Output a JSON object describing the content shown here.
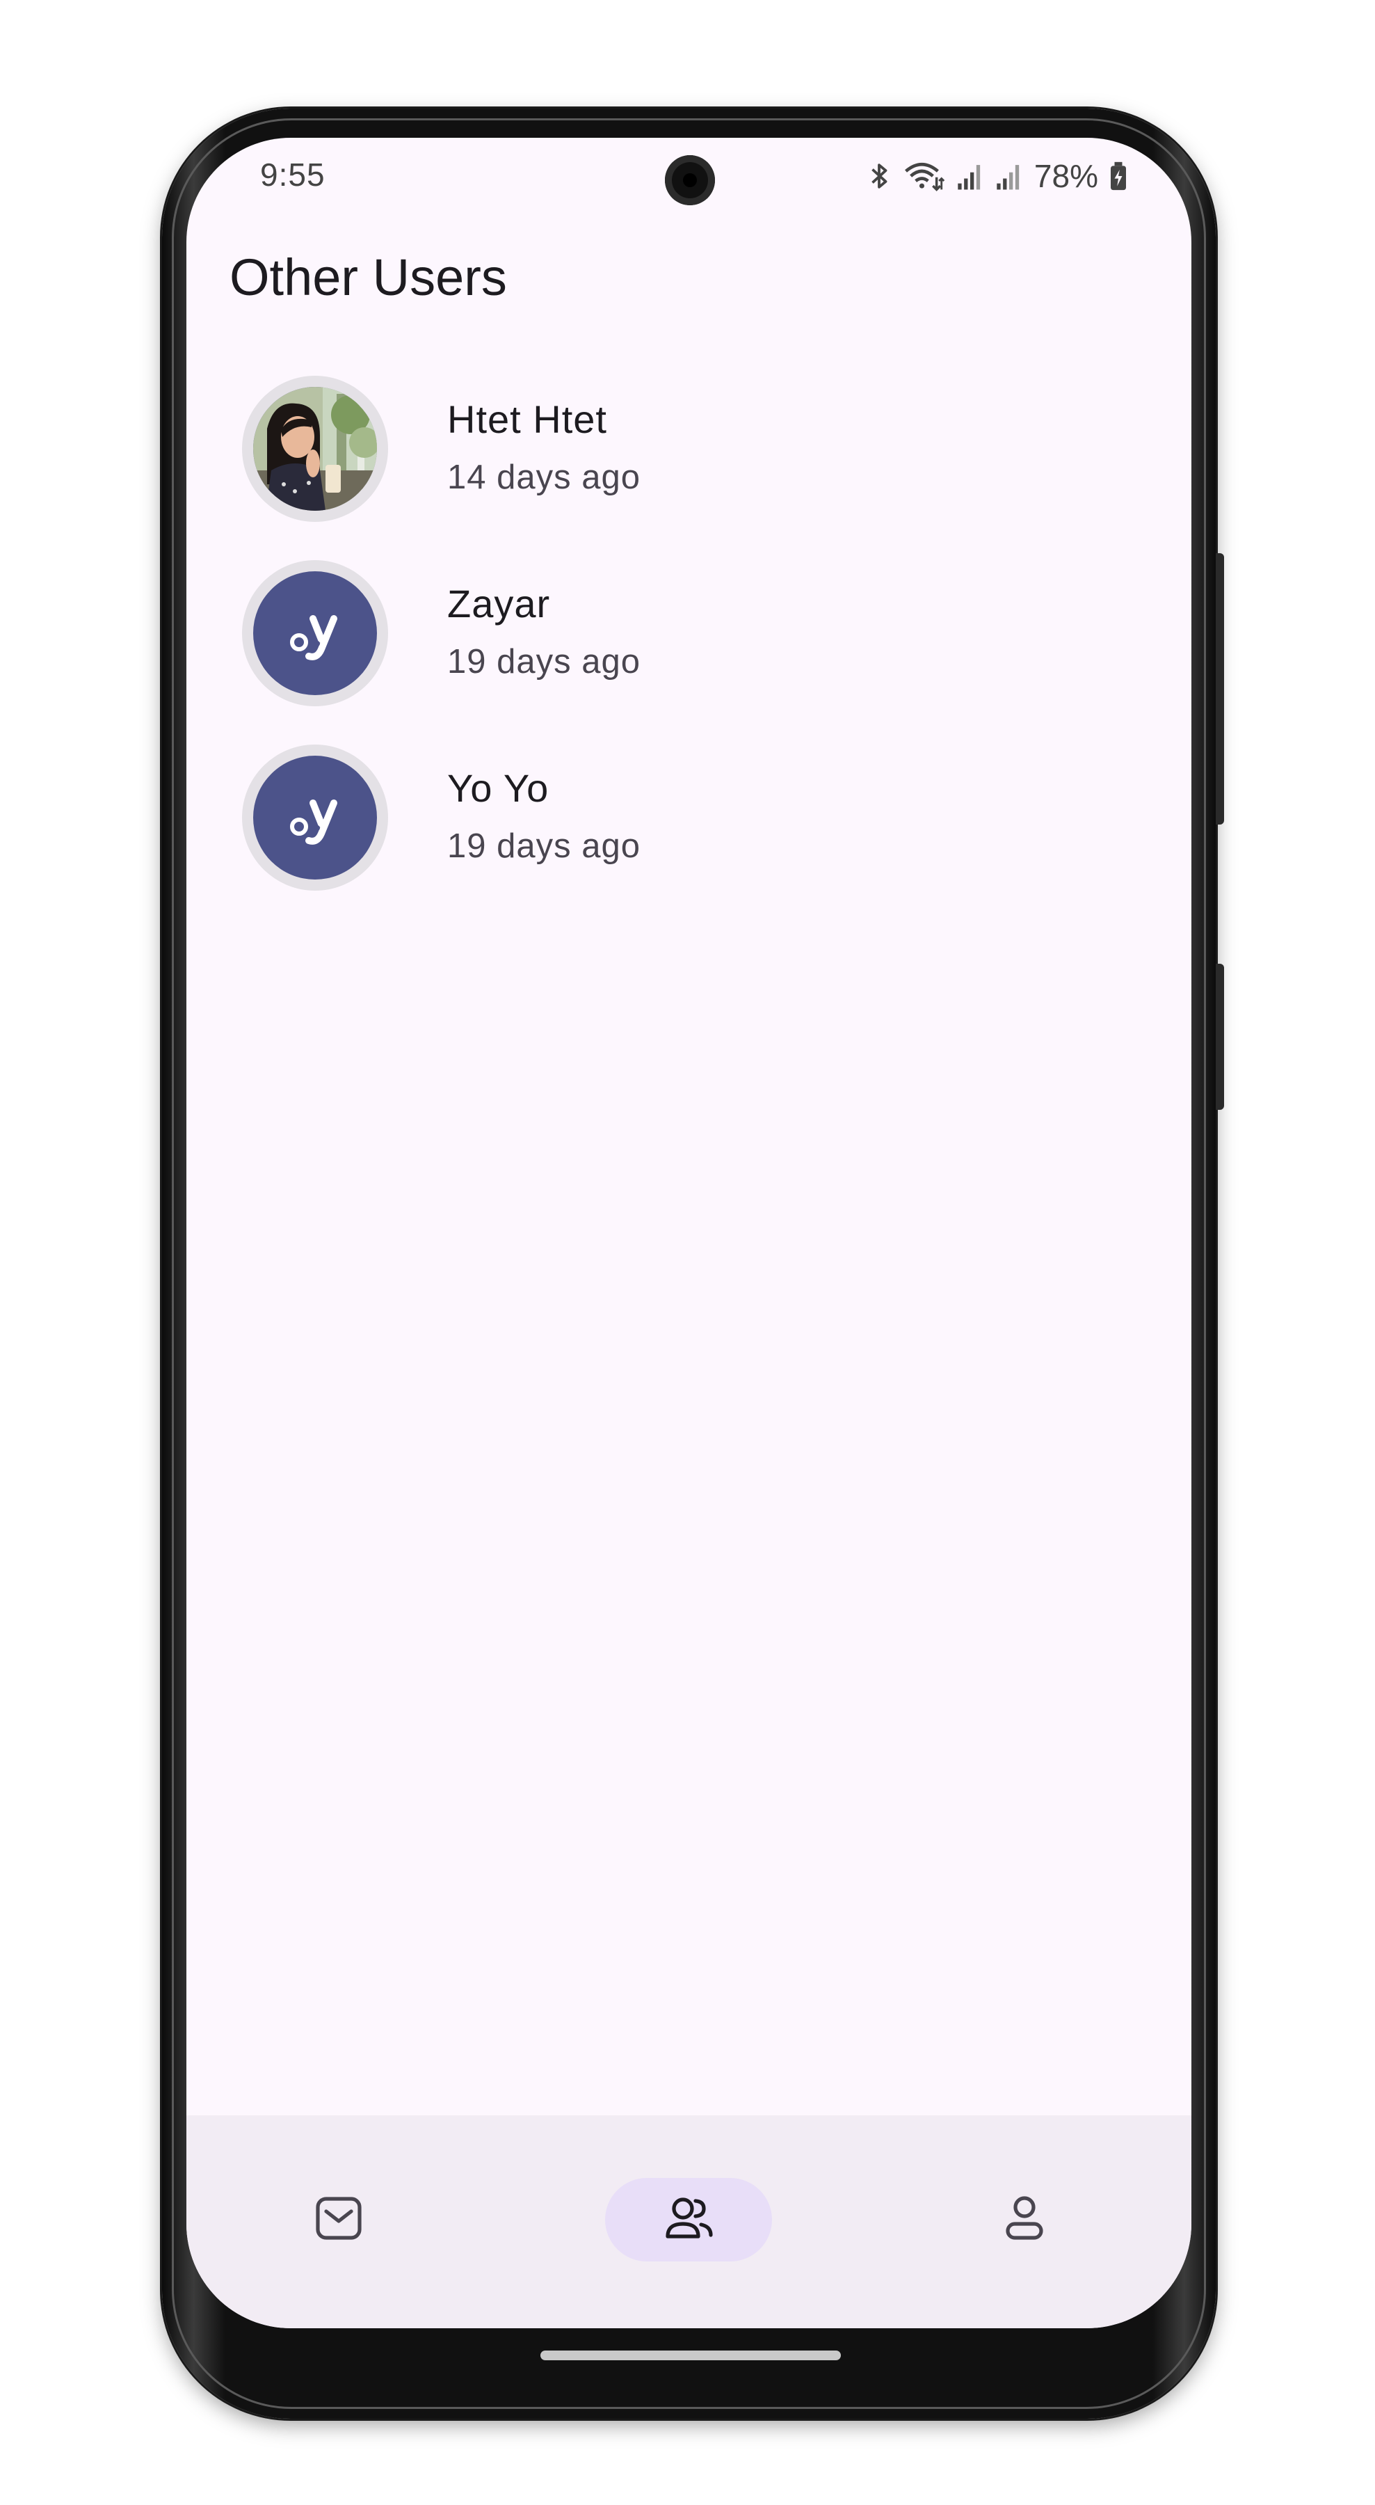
{
  "status_bar": {
    "time": "9:55",
    "battery": "78%",
    "icons": [
      "bluetooth-icon",
      "wifi-icon",
      "signal-icon",
      "signal-icon",
      "battery-charging-icon"
    ]
  },
  "header": {
    "title": "Other Users"
  },
  "users": [
    {
      "name": "Htet Htet",
      "last_seen": "14 days ago",
      "avatar": "photo"
    },
    {
      "name": "Zayar",
      "last_seen": "19 days ago",
      "avatar": "oy-logo"
    },
    {
      "name": "Yo Yo",
      "last_seen": "19 days ago",
      "avatar": "oy-logo"
    }
  ],
  "bottom_nav": {
    "items": [
      {
        "icon": "mail-icon",
        "active": false
      },
      {
        "icon": "users-icon",
        "active": true
      },
      {
        "icon": "person-icon",
        "active": false
      }
    ]
  },
  "colors": {
    "background": "#fdf7fe",
    "avatar_bg": "#4c538a",
    "avatar_ring": "#e4e1e6",
    "nav_bg": "#f2ecf4",
    "nav_active_pill": "#e8def8",
    "text_primary": "#1d1b20",
    "text_secondary": "#49454f"
  }
}
